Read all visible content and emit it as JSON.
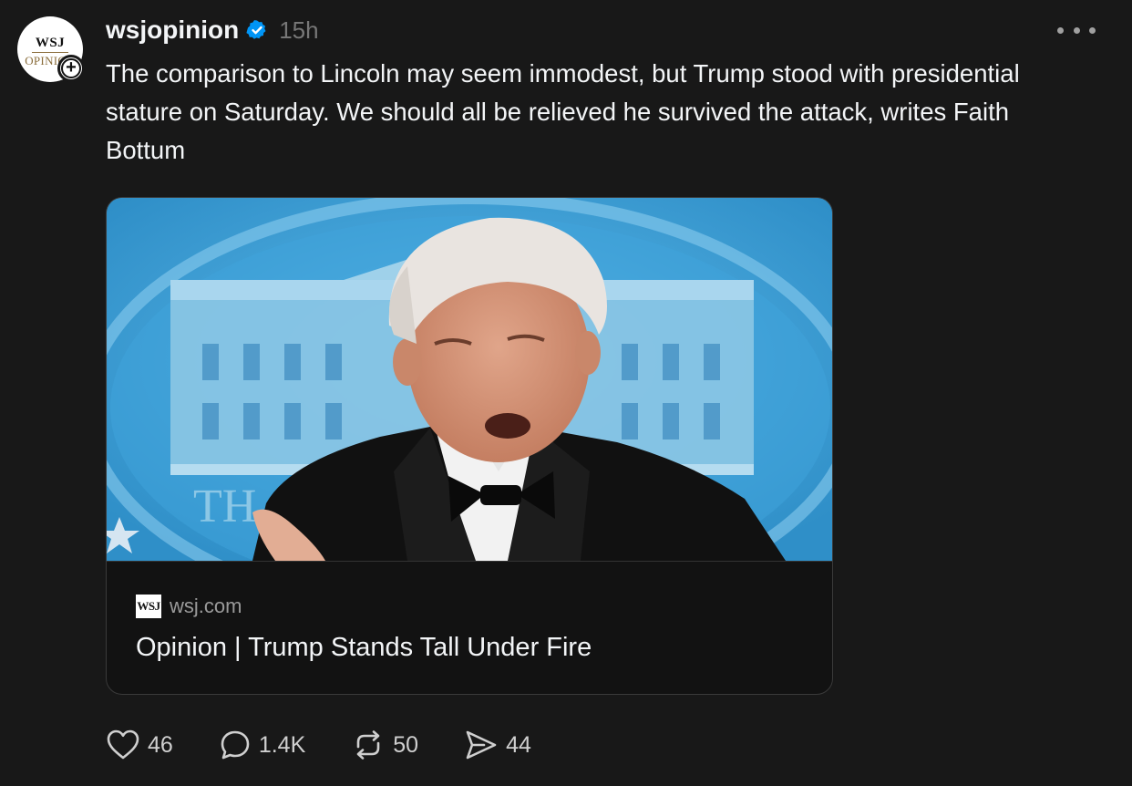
{
  "post": {
    "avatar_logo_top": "WSJ",
    "avatar_logo_bottom": "OPINION",
    "username": "wsjopinion",
    "time": "15h",
    "text": "The comparison to Lincoln may seem immodest, but Trump stood with presidential stature on Saturday. We should all be relieved he survived the attack, writes Faith Bottum"
  },
  "link_card": {
    "source_logo": "WSJ",
    "domain": "wsj.com",
    "headline": "Opinion | Trump Stands Tall Under Fire",
    "image_banner_text": "TH"
  },
  "actions": {
    "likes": "46",
    "replies": "1.4K",
    "reposts": "50",
    "shares": "44"
  },
  "colors": {
    "background": "#181818",
    "text": "#f3f5f7",
    "muted": "#777777",
    "verified": "#0095f6"
  }
}
